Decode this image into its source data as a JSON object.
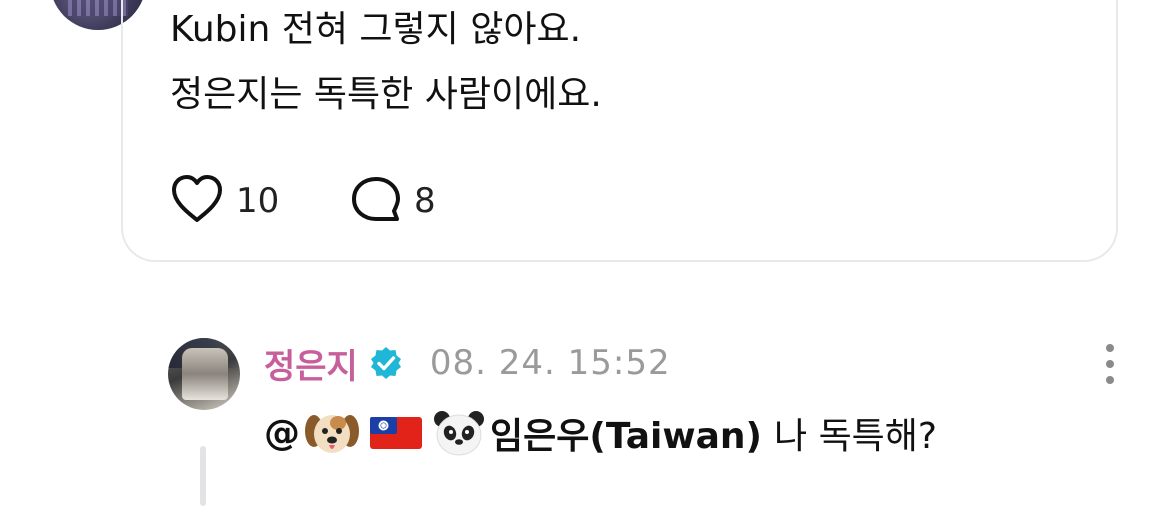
{
  "parent_post": {
    "lines": [
      "Kubin 전혀 그렇지 않아요.",
      "정은지는 독특한 사람이에요."
    ],
    "like_count": "10",
    "reply_count": "8"
  },
  "reply": {
    "username": "정은지",
    "timestamp": "08. 24. 15:52",
    "mention_prefix": "@",
    "mention_emojis": [
      "dog-face",
      "taiwan-flag",
      "panda-face"
    ],
    "mention_name": "임은우(Taiwan)",
    "text": "나 독특해?"
  },
  "colors": {
    "username": "#c7609a",
    "verified": "#1fb6d8",
    "muted": "#9a9a9a",
    "card_border": "#e9e9ec"
  }
}
